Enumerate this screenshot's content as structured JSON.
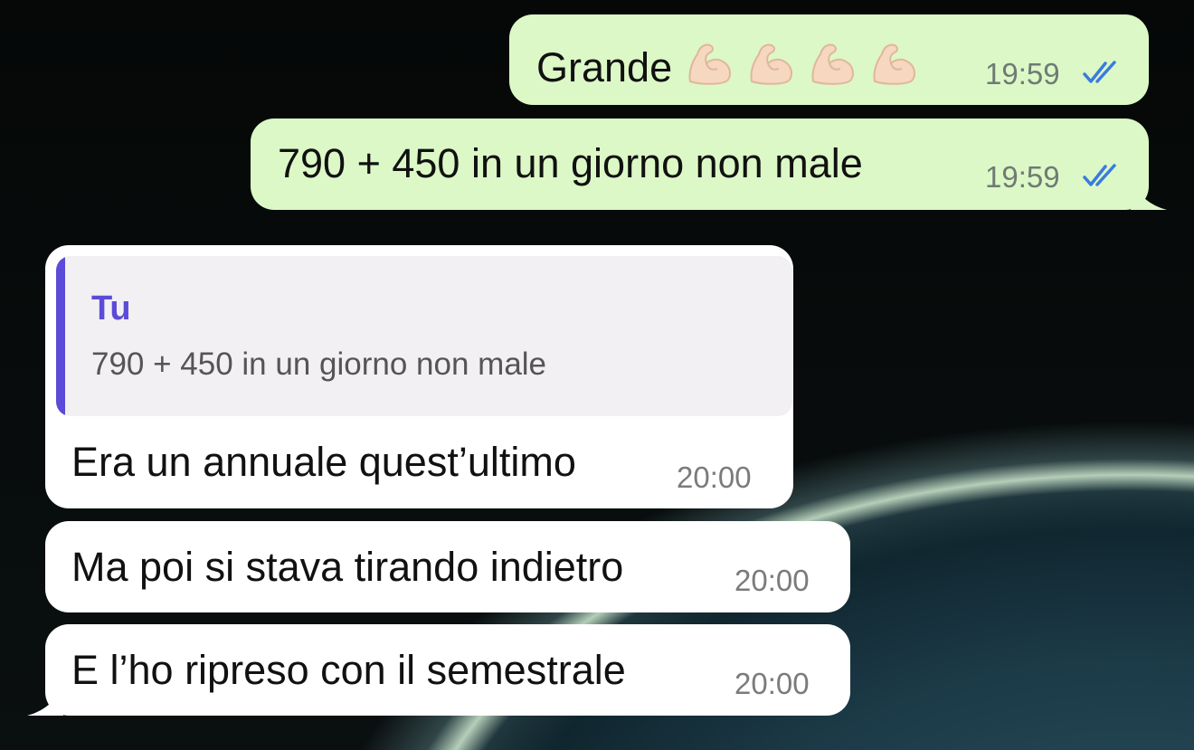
{
  "messages": [
    {
      "direction": "outgoing",
      "text": "Grande",
      "emoji": "flexed-biceps",
      "emoji_count": 4,
      "time": "19:59",
      "status": "read"
    },
    {
      "direction": "outgoing",
      "text": "790 + 450 in un giorno non male",
      "time": "19:59",
      "status": "read"
    },
    {
      "direction": "incoming",
      "reply": {
        "author": "Tu",
        "text": "790 + 450 in un giorno non male"
      },
      "text": "Era un annuale quest’ultimo",
      "time": "20:00"
    },
    {
      "direction": "incoming",
      "text": "Ma poi si stava tirando indietro",
      "time": "20:00"
    },
    {
      "direction": "incoming",
      "text": "E l’ho ripreso con il semestrale",
      "time": "20:00"
    }
  ],
  "colors": {
    "outgoing_bubble": "#dcf8c6",
    "incoming_bubble": "#ffffff",
    "reply_accent": "#5b4bd8",
    "read_ticks": "#3a7be0"
  },
  "icons": {
    "read_receipt": "double-check-icon",
    "emoji": "flexed-biceps-emoji"
  }
}
